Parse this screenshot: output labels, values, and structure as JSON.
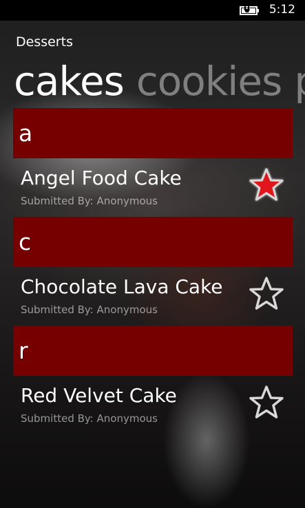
{
  "status_bar": {
    "time": "5:12",
    "battery_icon": "battery-charging-icon"
  },
  "app": {
    "title": "Desserts"
  },
  "pivot": {
    "tabs": [
      {
        "label": "cakes",
        "active": true
      },
      {
        "label": "cookies",
        "active": false
      },
      {
        "label": "p",
        "active": false
      }
    ]
  },
  "groups": [
    {
      "letter": "a",
      "items": [
        {
          "title": "Angel Food Cake",
          "submitted_by": "Submitted By: Anonymous",
          "favorite": true
        }
      ]
    },
    {
      "letter": "c",
      "items": [
        {
          "title": "Chocolate Lava Cake",
          "submitted_by": "Submitted By: Anonymous",
          "favorite": false
        }
      ]
    },
    {
      "letter": "r",
      "items": [
        {
          "title": "Red Velvet Cake",
          "submitted_by": "Submitted By: Anonymous",
          "favorite": false
        }
      ]
    }
  ],
  "colors": {
    "group_header_bg": "#760000",
    "star_favorite_fill": "#e0161b",
    "star_outline": "#d8d8d8"
  },
  "icons": {
    "favorite": "star-filled-icon",
    "not_favorite": "star-outline-icon"
  }
}
